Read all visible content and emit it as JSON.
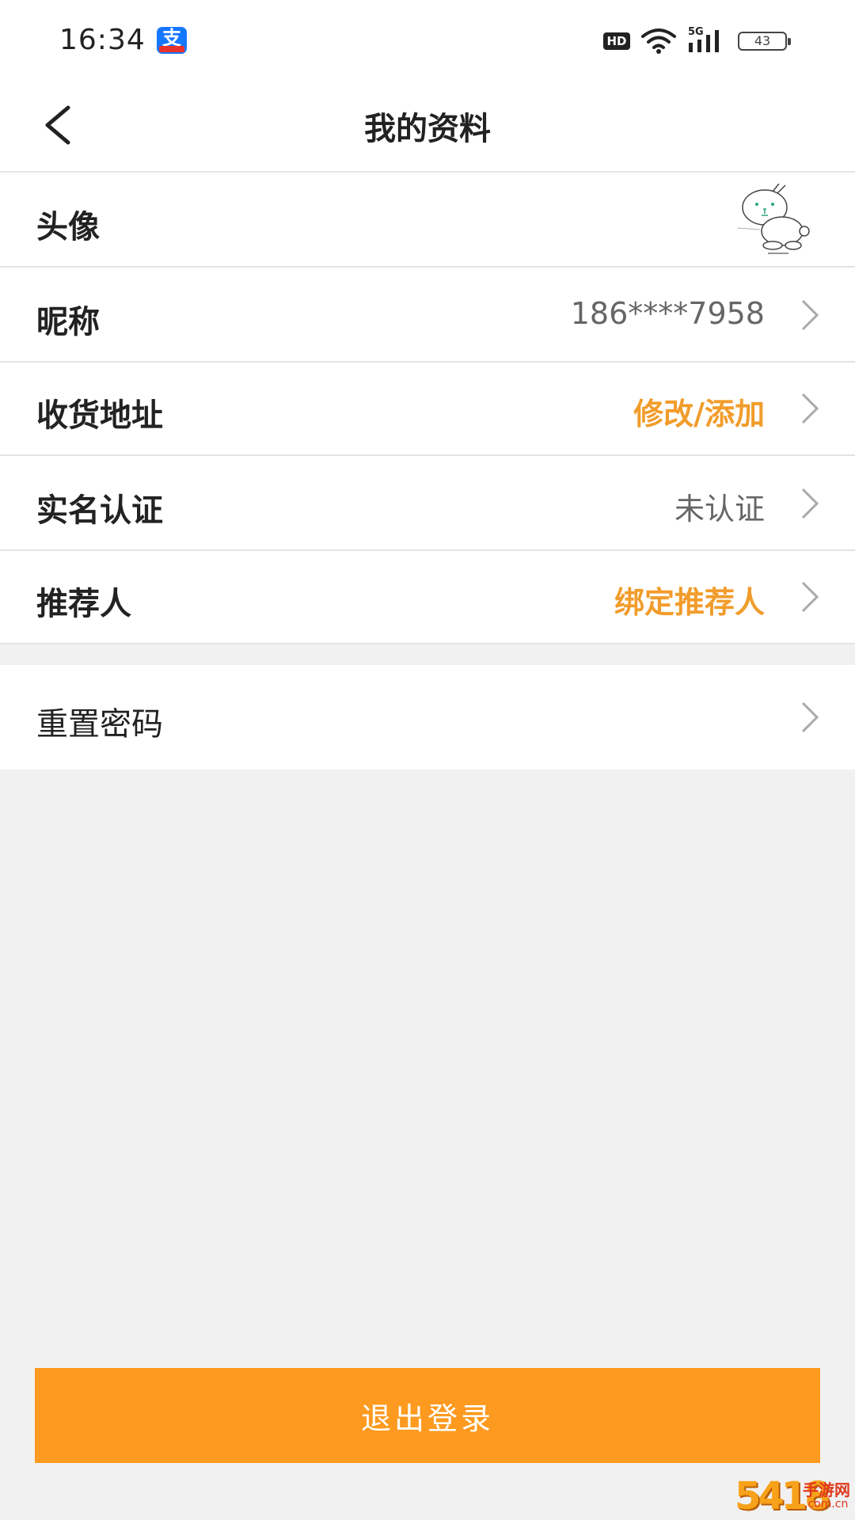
{
  "status_bar": {
    "time": "16:34",
    "app_icon": "alipay-icon",
    "alipay_glyph": "支",
    "hd": "HD",
    "network": "5G",
    "battery": "43"
  },
  "header": {
    "title": "我的资料",
    "back_icon": "chevron-left-icon"
  },
  "profile": {
    "avatar": {
      "label": "头像",
      "icon": "rabbit-avatar"
    },
    "nickname": {
      "label": "昵称",
      "value": "186****7958"
    },
    "address": {
      "label": "收货地址",
      "value": "修改/添加"
    },
    "real_name": {
      "label": "实名认证",
      "value": "未认证"
    },
    "referrer": {
      "label": "推荐人",
      "value": "绑定推荐人"
    }
  },
  "security": {
    "reset_password": {
      "label": "重置密码"
    }
  },
  "logout_label": "退出登录",
  "watermark": {
    "num": "5418",
    "cn": "手游网",
    "url": ".com.cn"
  },
  "colors": {
    "accent_orange": "#f19c2b",
    "button_orange": "#fd9a1f",
    "background": "#f1f1f1",
    "text_gray": "#666666"
  }
}
